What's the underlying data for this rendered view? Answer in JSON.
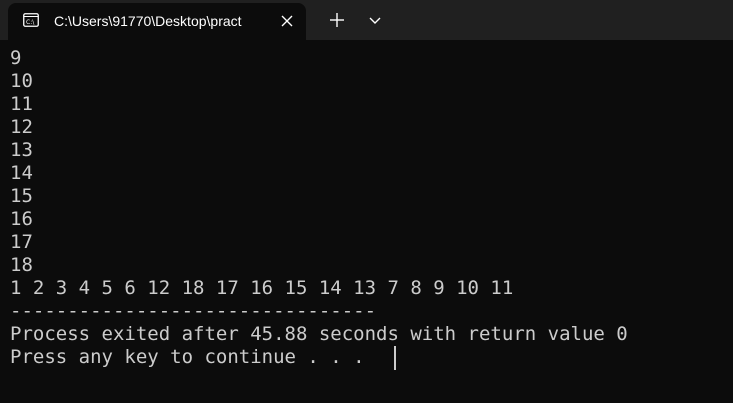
{
  "tab": {
    "title": "C:\\Users\\91770\\Desktop\\pract",
    "icon": "terminal-icon",
    "close_icon": "close-icon"
  },
  "toolbar": {
    "new_tab_icon": "plus-icon",
    "dropdown_icon": "chevron-down-icon"
  },
  "terminal": {
    "lines": [
      "9",
      "10",
      "11",
      "12",
      "13",
      "14",
      "15",
      "16",
      "17",
      "18",
      "1 2 3 4 5 6 12 18 17 16 15 14 13 7 8 9 10 11",
      "--------------------------------",
      "Process exited after 45.88 seconds with return value 0",
      "Press any key to continue . . ."
    ]
  },
  "colors": {
    "titlebar_bg": "#202020",
    "terminal_bg": "#0c0c0c",
    "text": "#cccccc"
  }
}
